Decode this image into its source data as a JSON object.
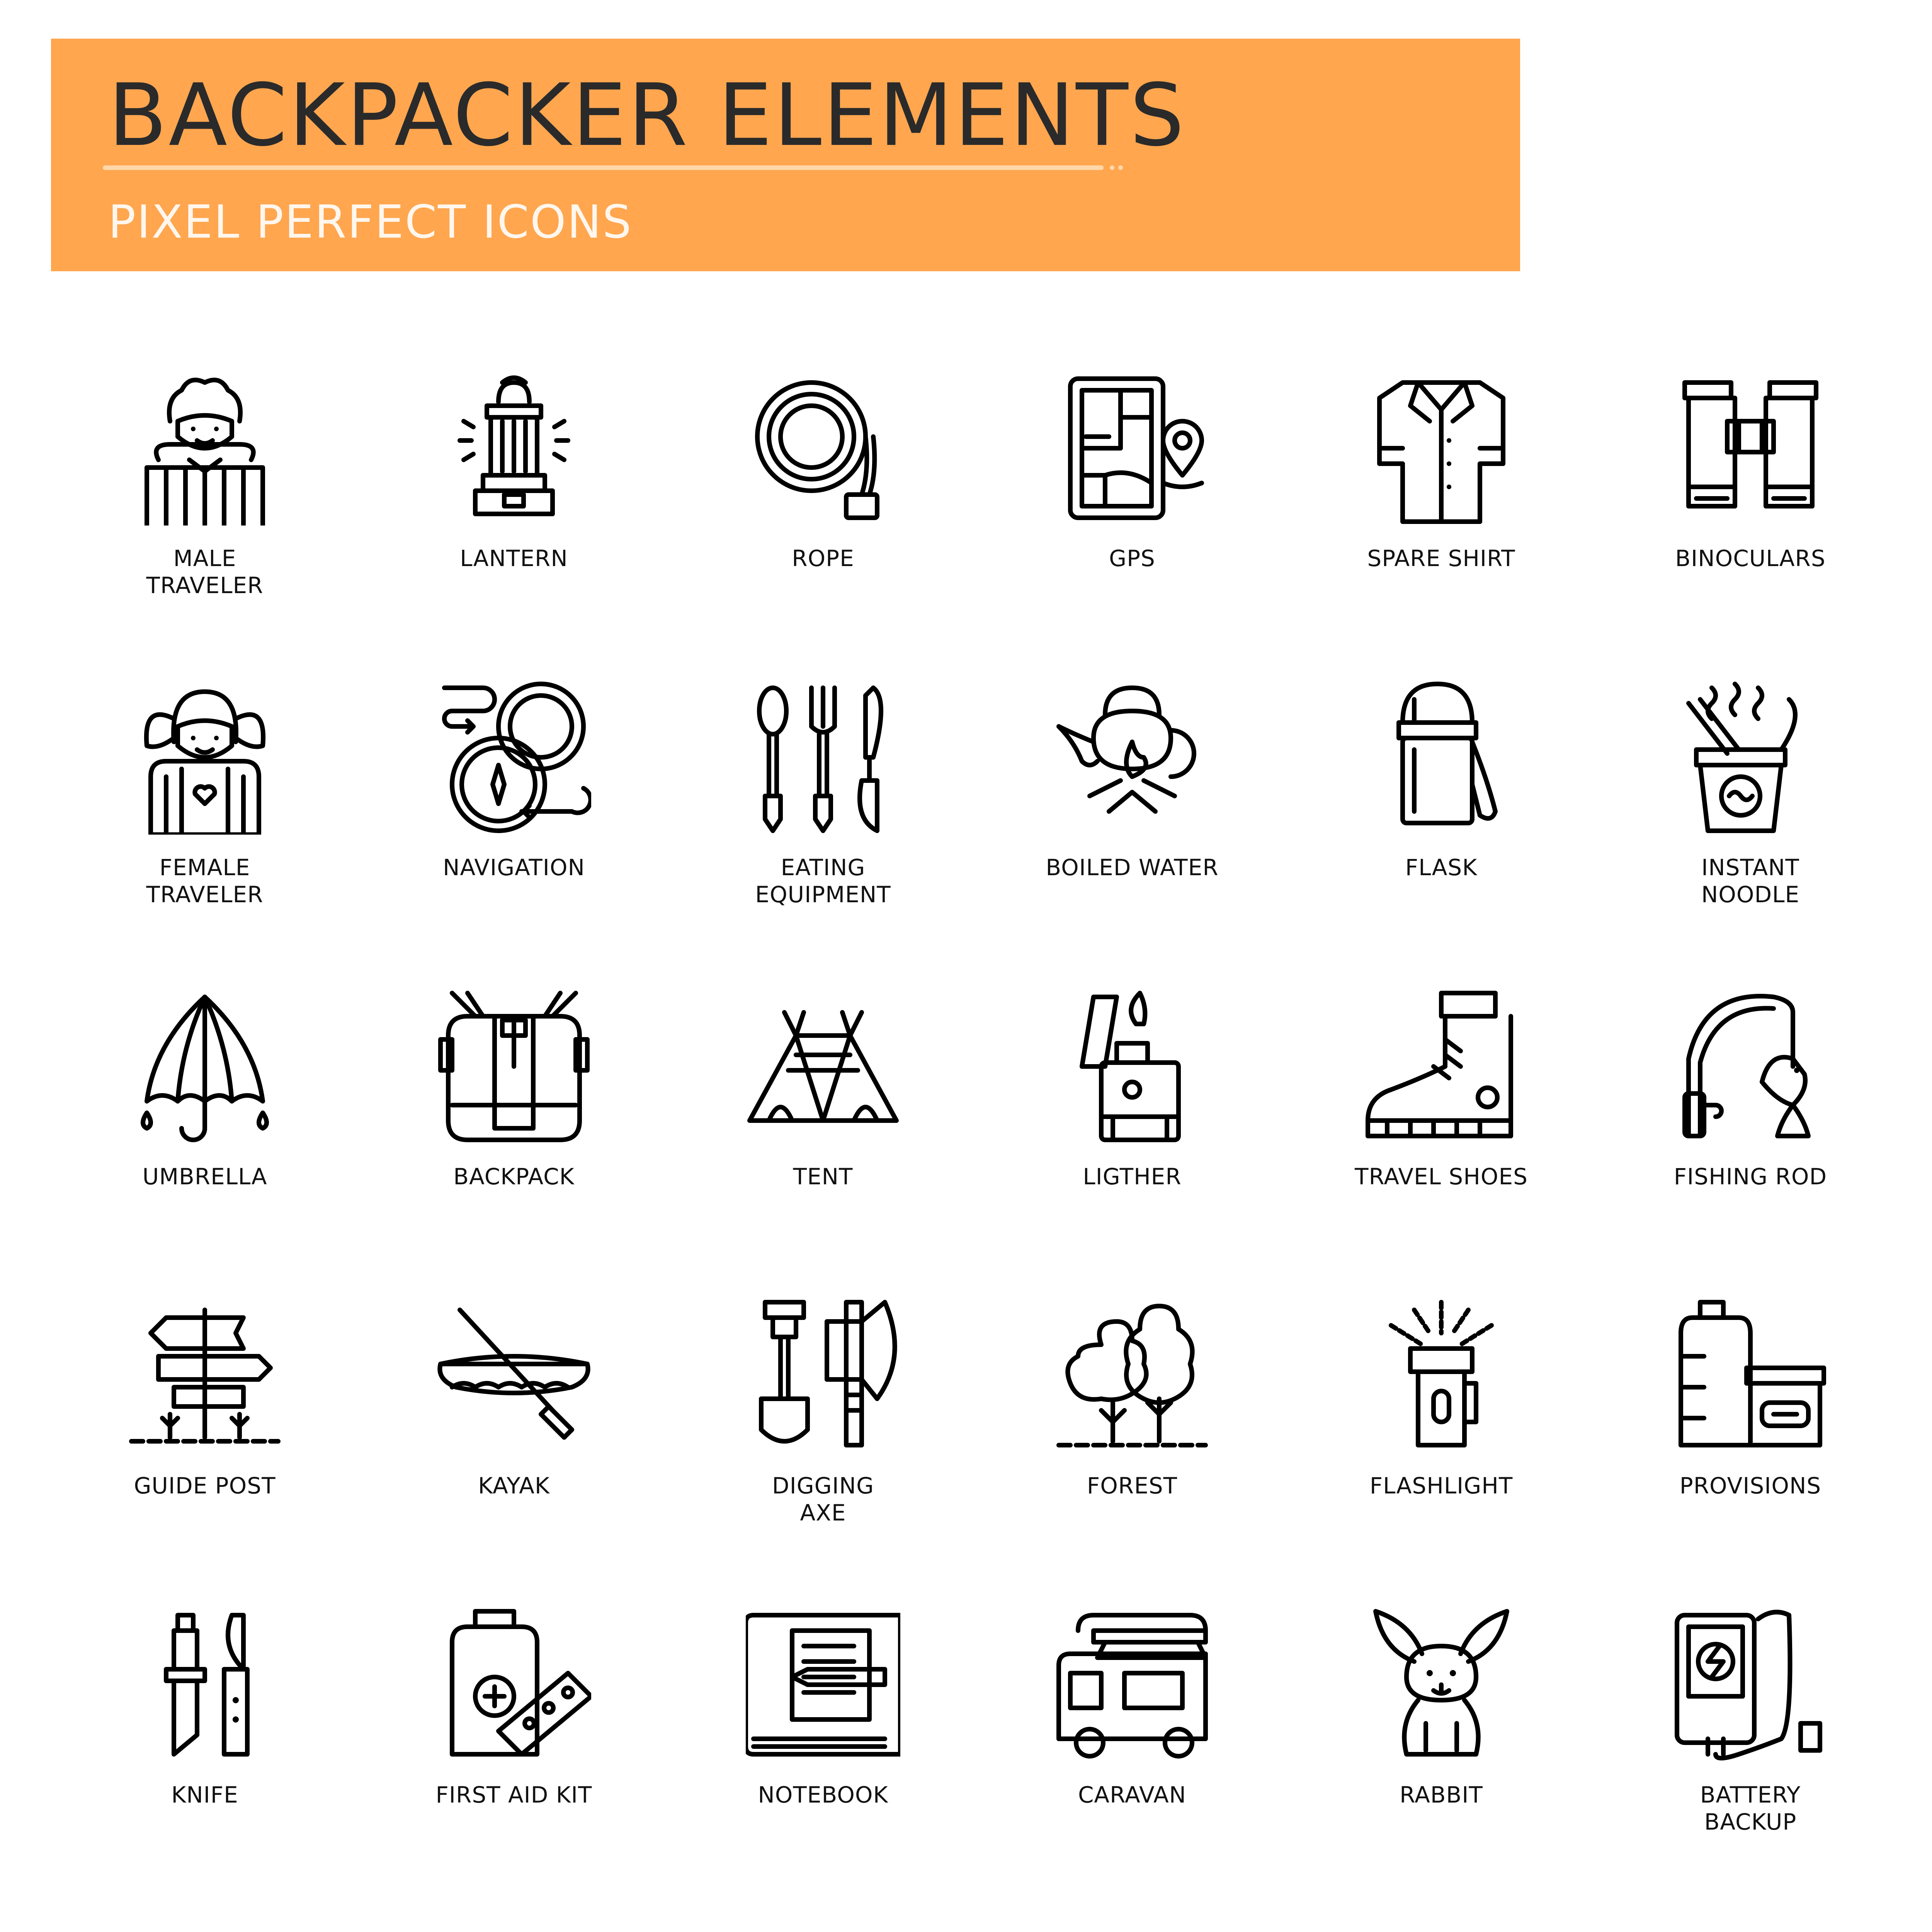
{
  "header": {
    "title": "BACKPACKER ELEMENTS",
    "subtitle": "PIXEL PERFECT ICONS",
    "accent": "#ffa64f"
  },
  "icons": [
    {
      "label": "MALE\nTRAVELER",
      "icon": "male-traveler-icon"
    },
    {
      "label": "LANTERN",
      "icon": "lantern-icon"
    },
    {
      "label": "ROPE",
      "icon": "rope-icon"
    },
    {
      "label": "GPS",
      "icon": "gps-icon"
    },
    {
      "label": "SPARE SHIRT",
      "icon": "shirt-icon"
    },
    {
      "label": "BINOCULARS",
      "icon": "binoculars-icon"
    },
    {
      "label": "FEMALE\nTRAVELER",
      "icon": "female-traveler-icon"
    },
    {
      "label": "NAVIGATION",
      "icon": "compass-icon"
    },
    {
      "label": "EATING\nEQUIPMENT",
      "icon": "cutlery-icon"
    },
    {
      "label": "BOILED WATER",
      "icon": "kettle-icon"
    },
    {
      "label": "FLASK",
      "icon": "flask-icon"
    },
    {
      "label": "INSTANT\nNOODLE",
      "icon": "noodle-cup-icon"
    },
    {
      "label": "UMBRELLA",
      "icon": "umbrella-icon"
    },
    {
      "label": "BACKPACK",
      "icon": "backpack-icon"
    },
    {
      "label": "TENT",
      "icon": "tent-icon"
    },
    {
      "label": "LIGTHER",
      "icon": "lighter-icon"
    },
    {
      "label": "TRAVEL SHOES",
      "icon": "boot-icon"
    },
    {
      "label": "FISHING ROD",
      "icon": "fishing-rod-icon"
    },
    {
      "label": "GUIDE POST",
      "icon": "signpost-icon"
    },
    {
      "label": "KAYAK",
      "icon": "kayak-icon"
    },
    {
      "label": "DIGGING\nAXE",
      "icon": "shovel-axe-icon"
    },
    {
      "label": "FOREST",
      "icon": "trees-icon"
    },
    {
      "label": "FLASHLIGHT",
      "icon": "flashlight-icon"
    },
    {
      "label": "PROVISIONS",
      "icon": "provisions-icon"
    },
    {
      "label": "KNIFE",
      "icon": "knife-icon"
    },
    {
      "label": "FIRST AID KIT",
      "icon": "first-aid-icon"
    },
    {
      "label": "NOTEBOOK",
      "icon": "notebook-icon"
    },
    {
      "label": "CARAVAN",
      "icon": "caravan-icon"
    },
    {
      "label": "RABBIT",
      "icon": "rabbit-icon"
    },
    {
      "label": "BATTERY\nBACKUP",
      "icon": "power-bank-icon"
    }
  ]
}
